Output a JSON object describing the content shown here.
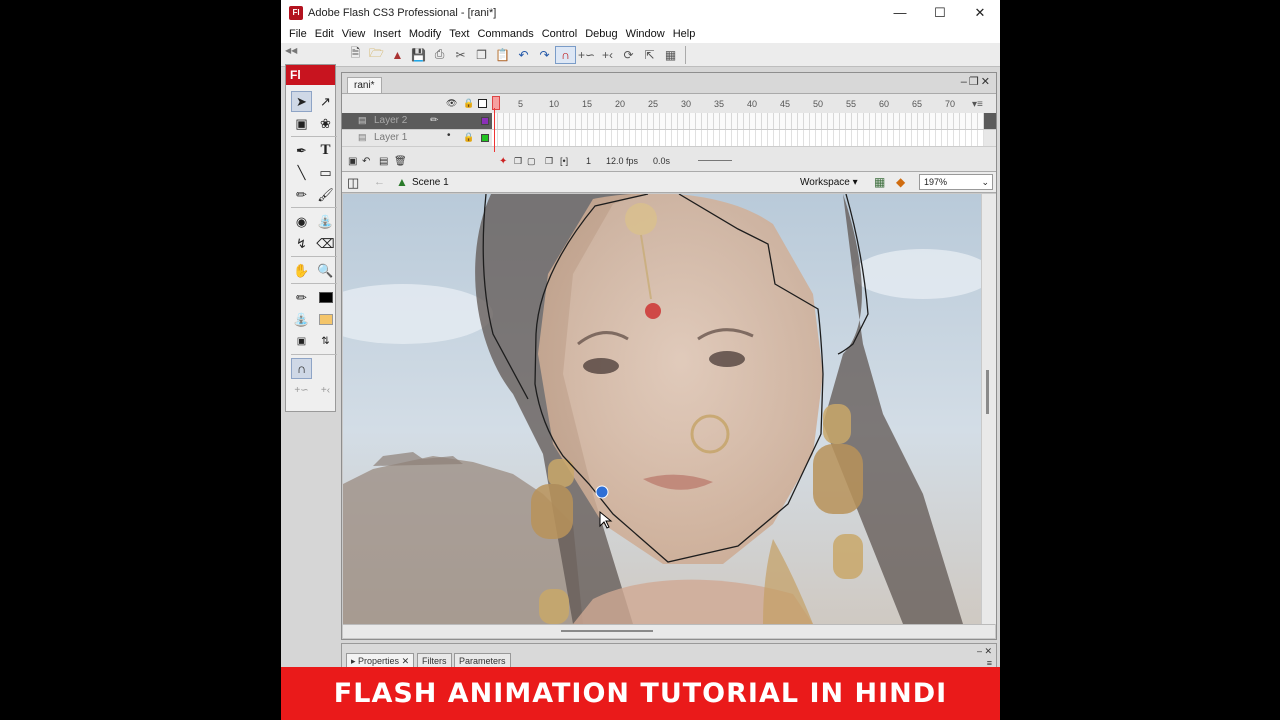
{
  "window": {
    "title": "Adobe Flash CS3 Professional - [rani*]",
    "app_icon": "Fl",
    "controls": [
      "minimize-icon",
      "maximize-icon",
      "close-icon"
    ]
  },
  "menubar": {
    "items": [
      "File",
      "Edit",
      "View",
      "Insert",
      "Modify",
      "Text",
      "Commands",
      "Control",
      "Debug",
      "Window",
      "Help"
    ]
  },
  "tools_panel": {
    "header": "Fl"
  },
  "document": {
    "tab": "rani*",
    "timeline": {
      "frame_numbers": [
        "5",
        "10",
        "15",
        "20",
        "25",
        "30",
        "35",
        "40",
        "45",
        "50",
        "55",
        "60",
        "65",
        "70"
      ],
      "layers": [
        {
          "name": "Layer 2",
          "color": "#8b2fb8",
          "active": true
        },
        {
          "name": "Layer 1",
          "color": "#22c322",
          "active": false
        }
      ],
      "current_frame": "1",
      "fps": "12.0 fps",
      "elapsed": "0.0s"
    },
    "edit_bar": {
      "scene": "Scene 1",
      "workspace": "Workspace ▾",
      "zoom": "197%"
    }
  },
  "properties_panel": {
    "tabs": [
      "Properties",
      "Filters",
      "Parameters"
    ]
  },
  "banner": {
    "text": "FLASH ANIMATION TUTORIAL IN HINDI",
    "color": "#ea1a1a"
  }
}
